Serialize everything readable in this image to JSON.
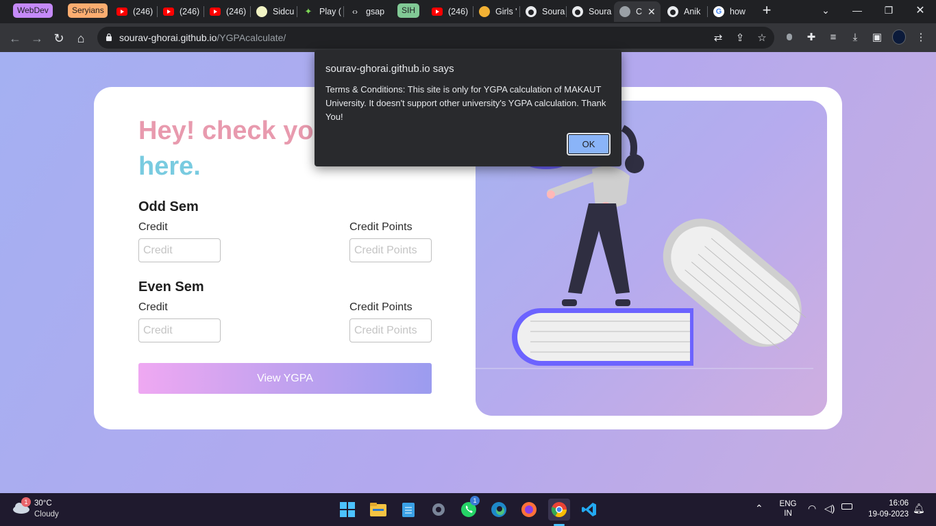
{
  "tabstrip": {
    "groups": [
      {
        "label": "WebDev",
        "color": "#c58af9"
      },
      {
        "label": "Seryians",
        "color": "#fcad70"
      },
      {
        "label": "SIH",
        "color": "#81c995"
      }
    ],
    "tabs": [
      {
        "title": "(246)",
        "icon": "youtube-icon"
      },
      {
        "title": "(246)",
        "icon": "youtube-icon"
      },
      {
        "title": "(246)",
        "icon": "youtube-icon"
      },
      {
        "title": "Sidcu",
        "icon": "site-icon"
      },
      {
        "title": "Play (",
        "icon": "game-icon"
      },
      {
        "title": "gsap",
        "icon": "code-icon"
      },
      {
        "title": "(246)",
        "icon": "youtube-icon"
      },
      {
        "title": "Girls '",
        "icon": "site-icon"
      },
      {
        "title": "Soura",
        "icon": "github-icon"
      },
      {
        "title": "Soura",
        "icon": "github-icon"
      },
      {
        "title": "C",
        "icon": "globe-icon"
      },
      {
        "title": "Anik",
        "icon": "github-icon"
      },
      {
        "title": "how",
        "icon": "google-icon"
      }
    ],
    "new_tab": "+"
  },
  "toolbar": {
    "url_host": "sourav-ghorai.github.io",
    "url_path": "/YGPAcalculate/"
  },
  "page": {
    "heading_line1": "Hey! check you",
    "heading_line2": "here.",
    "odd_sem": {
      "title": "Odd Sem",
      "credit_label": "Credit",
      "credit_placeholder": "Credit",
      "points_label": "Credit Points",
      "points_placeholder": "Credit Points"
    },
    "even_sem": {
      "title": "Even Sem",
      "credit_label": "Credit",
      "credit_placeholder": "Credit",
      "points_label": "Credit Points",
      "points_placeholder": "Credit Points"
    },
    "button_label": "View YGPA"
  },
  "dialog": {
    "title": "sourav-ghorai.github.io says",
    "message": "Terms & Conditions: This site is only for YGPA calculation of MAKAUT University. It doesn't support other university's YGPA calculation. Thank You!",
    "ok_label": "OK"
  },
  "taskbar": {
    "weather_temp": "30°C",
    "weather_desc": "Cloudy",
    "weather_badge": "1",
    "whatsapp_badge": "1",
    "lang_line1": "ENG",
    "lang_line2": "IN",
    "time": "16:06",
    "date": "19-09-2023"
  },
  "colors": {
    "accent_blue": "#8ab4f8",
    "heading_pink": "#e89aae",
    "heading_cyan": "#79cbe0",
    "book_border": "#6c63ff"
  }
}
